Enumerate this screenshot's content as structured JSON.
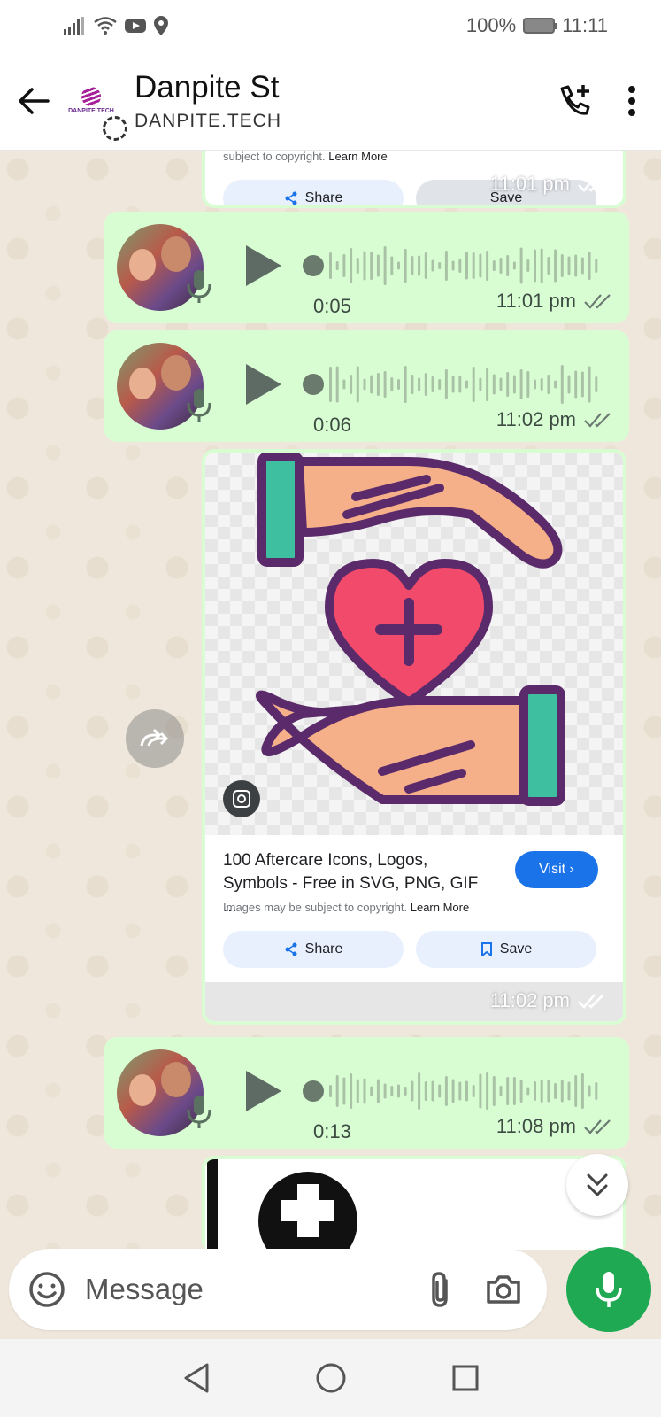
{
  "status_bar": {
    "battery": "100%",
    "time": "11:11"
  },
  "header": {
    "title": "Danpite St",
    "subtitle": "DANPITE.TECH",
    "logo_text": "DANPITE.TECH"
  },
  "messages": {
    "top_card": {
      "note": "subject to copyright.",
      "learn_more": "Learn More",
      "share": "Share",
      "save": "Save",
      "time": "11:01 pm"
    },
    "voice1": {
      "duration": "0:05",
      "time": "11:01 pm"
    },
    "voice2": {
      "duration": "0:06",
      "time": "11:02 pm"
    },
    "image_card": {
      "title": "100 Aftercare Icons, Logos, Symbols - Free in SVG, PNG, GIF ...",
      "note": "Images may be subject to copyright.",
      "learn_more": "Learn More",
      "visit": "Visit ›",
      "share": "Share",
      "save": "Save",
      "time": "11:02 pm"
    },
    "voice3": {
      "duration": "0:13",
      "time": "11:08 pm"
    }
  },
  "composer": {
    "placeholder": "Message"
  },
  "icons": {
    "back": "arrow-left-icon",
    "call_add": "phone-plus-icon",
    "menu": "more-vert-icon",
    "play": "play-icon",
    "mic": "mic-icon",
    "emoji": "emoji-icon",
    "attach": "paperclip-icon",
    "camera": "camera-icon",
    "forward": "forward-icon",
    "scroll": "double-chevron-down-icon"
  },
  "colors": {
    "bubble": "#d9fdd3",
    "chat_bg": "#efe7dc",
    "accent": "#1ea952",
    "visit": "#1a73e8"
  }
}
